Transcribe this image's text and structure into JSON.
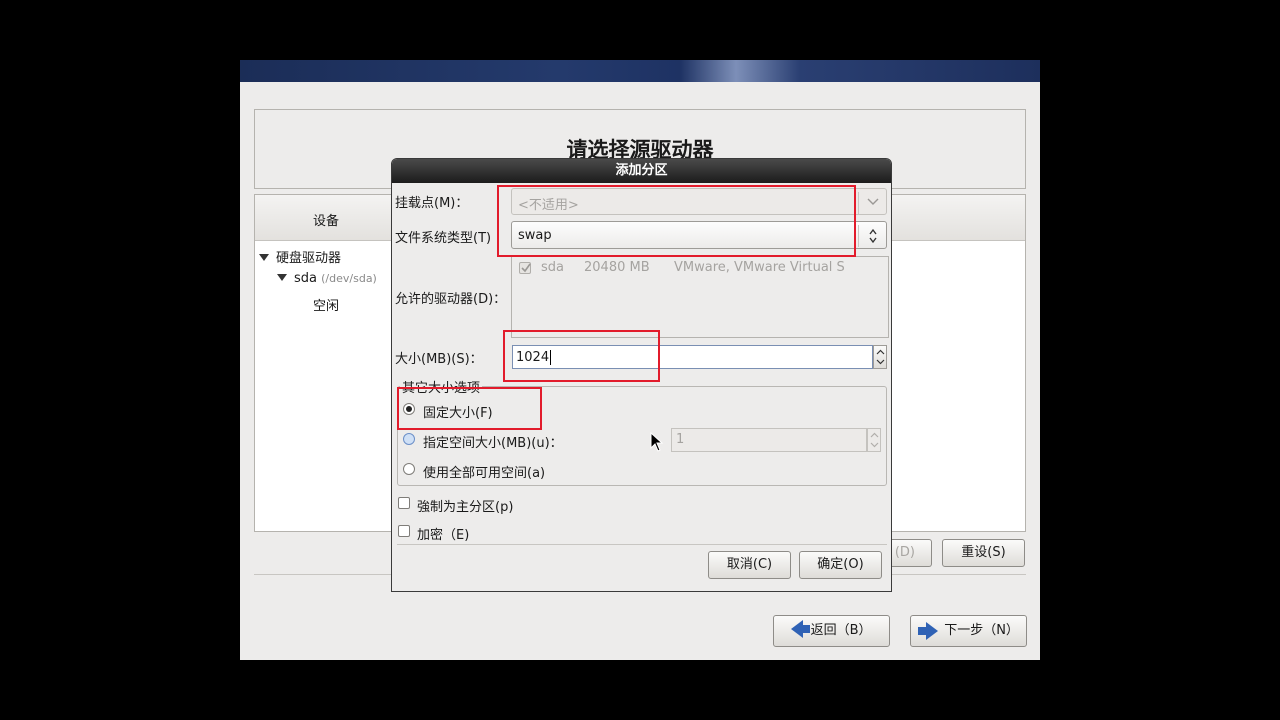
{
  "installer": {
    "page_title": "请选择源驱动器",
    "device_column": "设备",
    "tree": {
      "group": "硬盘驱动器",
      "disk": "sda",
      "disk_path": "(/dev/sda)",
      "free": "空闲"
    },
    "buttons": {
      "delete_suffix": "(D)",
      "reset": "重设(S)",
      "back": "返回（B）",
      "next": "下一步（N）"
    }
  },
  "dialog": {
    "title": "添加分区",
    "mount_point": {
      "label": "挂载点(M)：",
      "placeholder": "<不适用>"
    },
    "fs_type": {
      "label": "文件系统类型(T)",
      "value": "swap"
    },
    "allowed_drives": {
      "label": "允许的驱动器(D)：",
      "rows": [
        {
          "checked": true,
          "name": "sda",
          "size": "20480 MB",
          "model": "VMware, VMware Virtual S"
        }
      ]
    },
    "size": {
      "label": "大小(MB)(S)：",
      "value": "1024"
    },
    "other_size_options": {
      "legend": "其它大小选项",
      "fixed": "固定大小(F)",
      "fill_up_to": "指定空间大小(MB)(u)：",
      "fill_up_to_value": "1",
      "fill_all": "使用全部可用空间(a)",
      "selected": "fixed"
    },
    "force_primary": "強制为主分区(p)",
    "encrypt": "加密（E)",
    "cancel": "取消(C)",
    "ok": "确定(O)"
  },
  "colors": {
    "highlight": "#e21b2b",
    "title_bar": "#2b2b2b",
    "banner": "#1e3263"
  }
}
